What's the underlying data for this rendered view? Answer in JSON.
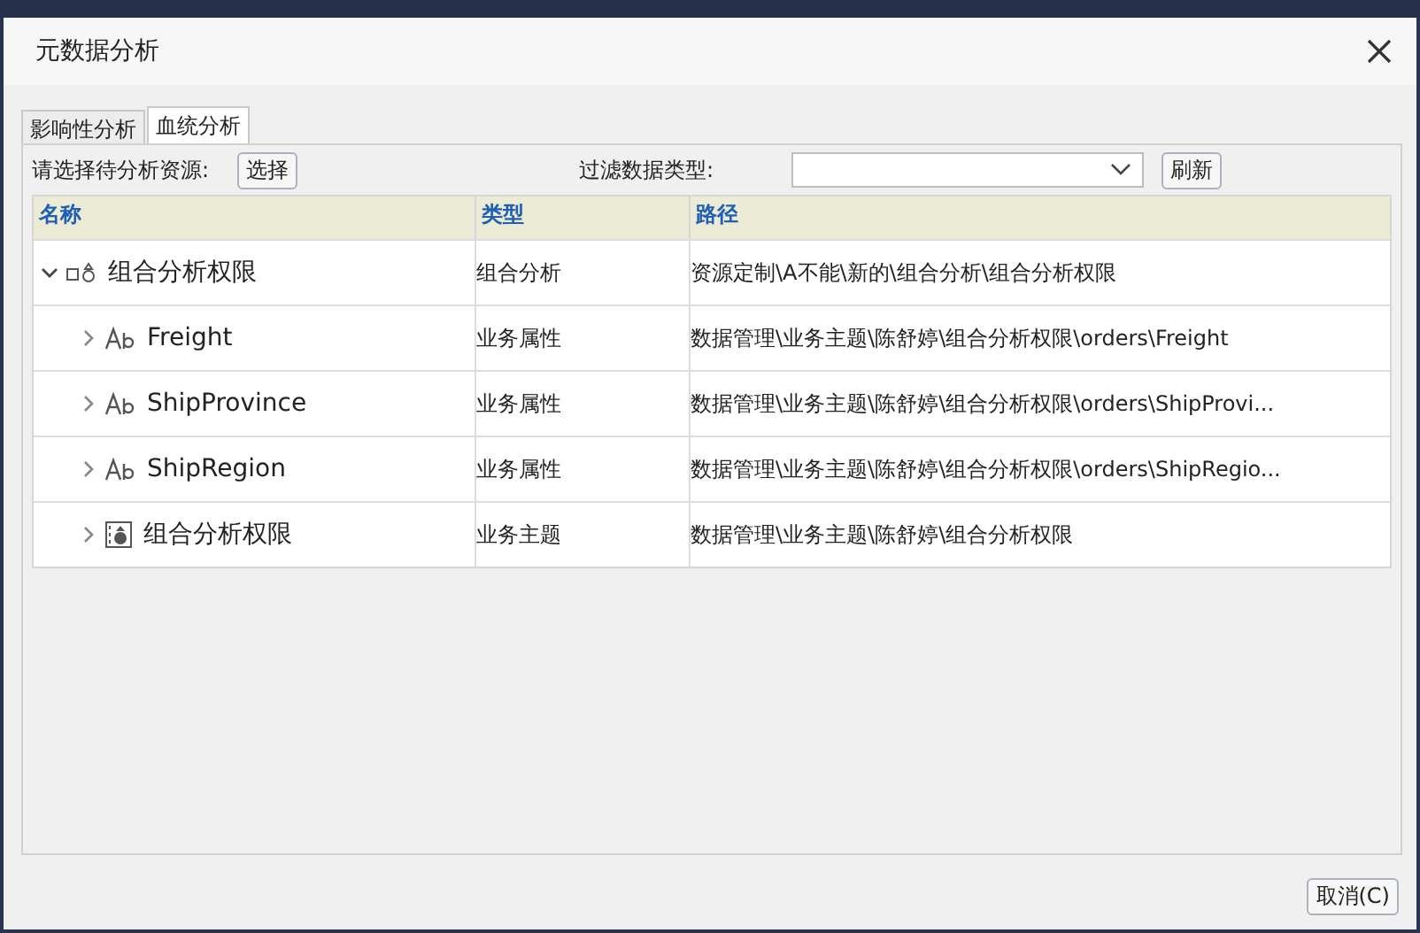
{
  "window": {
    "title": "元数据分析"
  },
  "tabs": [
    {
      "label": "影响性分析",
      "selected": false
    },
    {
      "label": "血统分析",
      "selected": true
    }
  ],
  "toolbar": {
    "resource_label": "请选择待分析资源:",
    "select_button": "选择",
    "filter_label": "过滤数据类型:",
    "refresh_button": "刷新"
  },
  "table": {
    "columns": [
      "名称",
      "类型",
      "路径"
    ],
    "rows": [
      {
        "name": "组合分析权限",
        "kind": "combo",
        "type": "组合分析",
        "path": "资源定制\\A不能\\新的\\组合分析\\组合分析权限",
        "expanded": true,
        "children": [
          {
            "name": "Freight",
            "kind": "field",
            "type": "业务属性",
            "path": "数据管理\\业务主题\\陈舒婷\\组合分析权限\\orders\\Freight",
            "expanded": false
          },
          {
            "name": "ShipProvince",
            "kind": "field",
            "type": "业务属性",
            "path": "数据管理\\业务主题\\陈舒婷\\组合分析权限\\orders\\ShipProvi...",
            "expanded": false
          },
          {
            "name": "ShipRegion",
            "kind": "field",
            "type": "业务属性",
            "path": "数据管理\\业务主题\\陈舒婷\\组合分析权限\\orders\\ShipRegio...",
            "expanded": false
          },
          {
            "name": "组合分析权限",
            "kind": "theme",
            "type": "业务主题",
            "path": "数据管理\\业务主题\\陈舒婷\\组合分析权限",
            "expanded": false
          }
        ]
      }
    ]
  },
  "buttons": [
    "取消(C)"
  ]
}
